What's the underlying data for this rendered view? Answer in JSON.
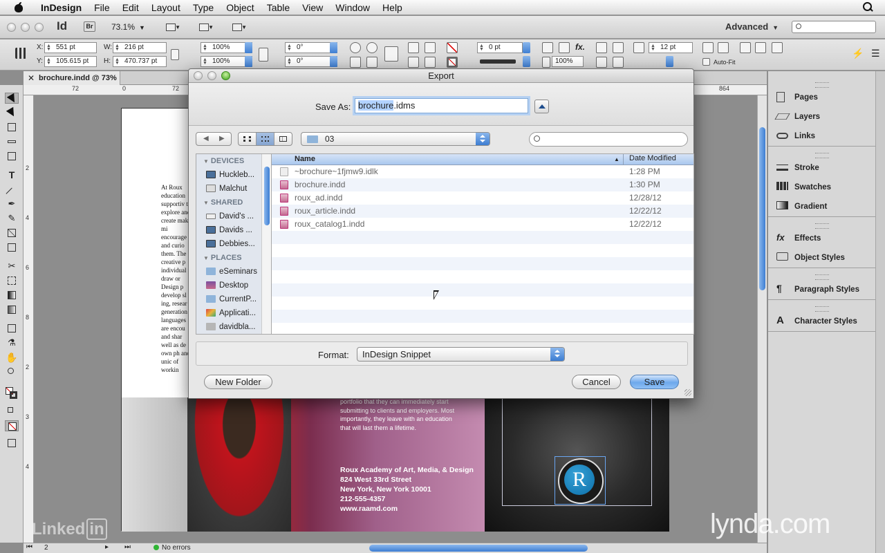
{
  "menubar": {
    "app_name": "InDesign",
    "items": [
      "File",
      "Edit",
      "Layout",
      "Type",
      "Object",
      "Table",
      "View",
      "Window",
      "Help"
    ]
  },
  "appbar": {
    "logo": "Id",
    "bridge": "Br",
    "zoom": "73.1%",
    "workspace": "Advanced"
  },
  "control": {
    "x_label": "X:",
    "x": "551 pt",
    "y_label": "Y:",
    "y": "105.615 pt",
    "w_label": "W:",
    "w": "216 pt",
    "h_label": "H:",
    "h": "470.737 pt",
    "scale_x": "100%",
    "scale_y": "100%",
    "rotate": "0°",
    "shear": "0°",
    "stroke_weight": "0 pt",
    "opacity": "100%",
    "spacing": "12 pt",
    "autofit": "Auto-Fit"
  },
  "document": {
    "tab": "brochure.indd @ 73%",
    "ruler_h": [
      "72",
      "0",
      "72",
      "864"
    ],
    "ruler_v": [
      "2",
      "4",
      "6",
      "8",
      "2",
      "3",
      "4"
    ],
    "body_text": "At Roux education supportiv to explore and create make mi encourage and curio them. The creative p individual to draw or Design p develop sl ing, resear generation languages are encou and shar well as de own ph and unic of workin",
    "promo_text": "portfolio that they can immediately start submitting to clients and employers. Most importantly, they leave with an education that will last them a lifetime.",
    "address": [
      "Roux Academy of Art, Media, & Design",
      "824 West 33rd Street",
      "New York, New York 10001",
      "212-555-4357",
      "www.raamd.com"
    ],
    "logo_letter": "R"
  },
  "status": {
    "page": "2",
    "errors": "No errors"
  },
  "panels": {
    "group1": [
      "Pages",
      "Layers",
      "Links"
    ],
    "group2": [
      "Stroke",
      "Swatches",
      "Gradient"
    ],
    "group3": [
      "Effects",
      "Object Styles"
    ],
    "group4": [
      "Paragraph Styles"
    ],
    "group5": [
      "Character Styles"
    ]
  },
  "dialog": {
    "title": "Export",
    "save_as_label": "Save As:",
    "filename_base": "brochure",
    "filename_ext": ".idms",
    "folder": "03",
    "sidebar": {
      "devices_label": "DEVICES",
      "devices": [
        "Huckleb...",
        "Malchut"
      ],
      "shared_label": "SHARED",
      "shared": [
        "David's ...",
        "Davids ...",
        "Debbies..."
      ],
      "places_label": "PLACES",
      "places": [
        "eSeminars",
        "Desktop",
        "CurrentP...",
        "Applicati...",
        "davidbla..."
      ]
    },
    "columns": {
      "name": "Name",
      "date": "Date Modified"
    },
    "files": [
      {
        "name": "~brochure~1fjmw9.idlk",
        "date": "1:28 PM"
      },
      {
        "name": "brochure.indd",
        "date": "1:30 PM"
      },
      {
        "name": "roux_ad.indd",
        "date": "12/28/12"
      },
      {
        "name": "roux_article.indd",
        "date": "12/22/12"
      },
      {
        "name": "roux_catalog1.indd",
        "date": "12/22/12"
      }
    ],
    "format_label": "Format:",
    "format_value": "InDesign Snippet",
    "new_folder": "New Folder",
    "cancel": "Cancel",
    "save": "Save"
  },
  "watermarks": {
    "lynda": "lynda.com",
    "linked": "Linked",
    "in": "in"
  }
}
